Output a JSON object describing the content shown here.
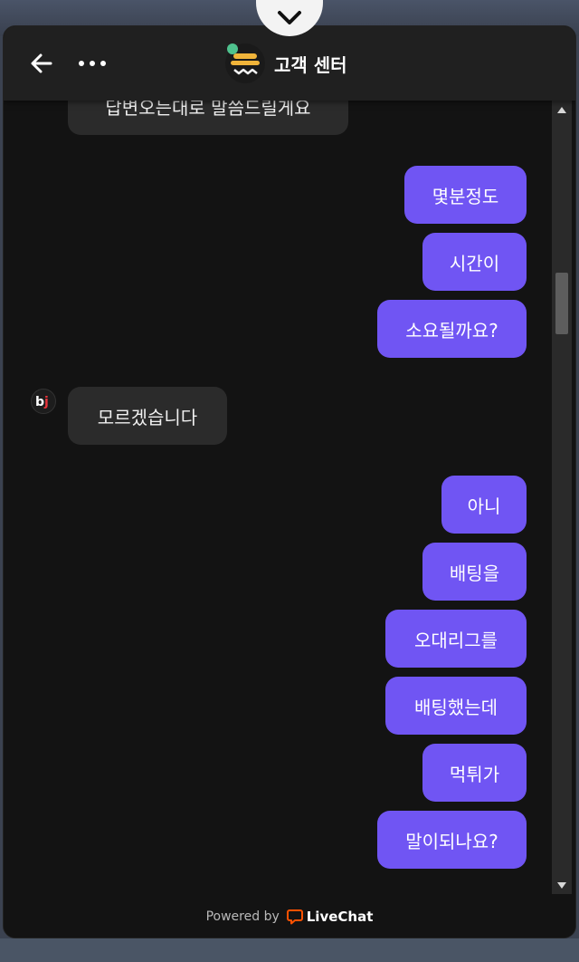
{
  "header": {
    "title": "고객 센터",
    "back_icon": "arrow-left-icon",
    "more_icon": "more-dots-icon"
  },
  "messages": [
    {
      "sender": "agent",
      "text": "답변오는대로 말씀드릴게요"
    },
    {
      "sender": "visitor",
      "text": "몇분정도"
    },
    {
      "sender": "visitor",
      "text": "시간이"
    },
    {
      "sender": "visitor",
      "text": "소요될까요?"
    },
    {
      "sender": "agent",
      "text": "모르겠습니다"
    },
    {
      "sender": "visitor",
      "text": "아니"
    },
    {
      "sender": "visitor",
      "text": "배팅을"
    },
    {
      "sender": "visitor",
      "text": "오대리그를"
    },
    {
      "sender": "visitor",
      "text": "배팅했는데"
    },
    {
      "sender": "visitor",
      "text": "먹튀가"
    },
    {
      "sender": "visitor",
      "text": "말이되나요?"
    }
  ],
  "agent_avatar": {
    "label": "bj"
  },
  "footer": {
    "powered_by": "Powered by",
    "brand": "LiveChat"
  },
  "colors": {
    "visitor_bubble": "#7055f3",
    "agent_bubble": "#2b2b2b",
    "background": "#131313",
    "online": "#4fc28e",
    "brand": "#ff5100"
  }
}
